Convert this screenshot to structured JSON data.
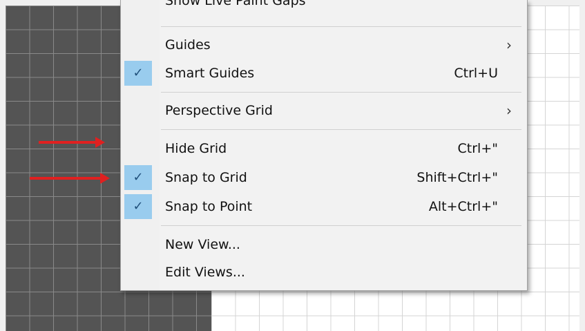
{
  "menu": {
    "items": [
      {
        "label": "Show Live Paint Gaps",
        "shortcut": "",
        "checked": false,
        "submenu": false
      },
      {
        "label": "Guides",
        "shortcut": "",
        "checked": false,
        "submenu": true
      },
      {
        "label": "Smart Guides",
        "shortcut": "Ctrl+U",
        "checked": true,
        "submenu": false
      },
      {
        "label": "Perspective Grid",
        "shortcut": "",
        "checked": false,
        "submenu": true
      },
      {
        "label": "Hide Grid",
        "shortcut": "Ctrl+\"",
        "checked": false,
        "submenu": false
      },
      {
        "label": "Snap to Grid",
        "shortcut": "Shift+Ctrl+\"",
        "checked": true,
        "submenu": false
      },
      {
        "label": "Snap to Point",
        "shortcut": "Alt+Ctrl+\"",
        "checked": true,
        "submenu": false
      },
      {
        "label": "New View...",
        "shortcut": "",
        "checked": false,
        "submenu": false
      },
      {
        "label": "Edit Views...",
        "shortcut": "",
        "checked": false,
        "submenu": false
      }
    ],
    "check_glyph": "✓",
    "submenu_glyph": "›"
  },
  "annotations": {
    "arrow_color": "#e02020",
    "arrows_point_to": [
      "Hide Grid",
      "Snap to Grid"
    ]
  },
  "colors": {
    "check_highlight": "#99ccee",
    "dark_canvas": "#545454"
  }
}
